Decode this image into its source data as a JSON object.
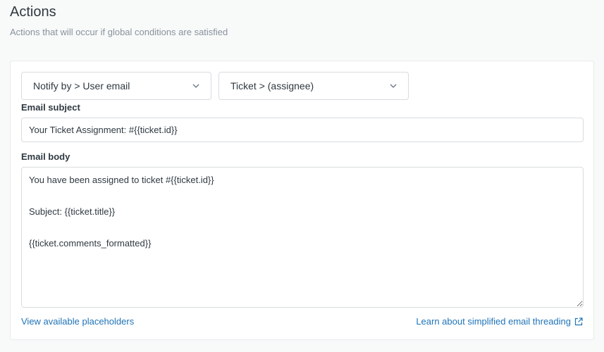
{
  "header": {
    "title": "Actions",
    "subtitle": "Actions that will occur if global conditions are satisfied"
  },
  "actions": {
    "notify_select": {
      "value": "Notify by > User email",
      "icon": "chevron-down-icon"
    },
    "recipient_select": {
      "value": "Ticket > (assignee)",
      "icon": "chevron-down-icon"
    },
    "email_subject": {
      "label": "Email subject",
      "value": "Your Ticket Assignment: #{{ticket.id}}"
    },
    "email_body": {
      "label": "Email body",
      "value": "You have been assigned to ticket #{{ticket.id}}\n\nSubject: {{ticket.title}}\n\n{{ticket.comments_formatted}}"
    },
    "links": {
      "placeholders": "View available placeholders",
      "threading": "Learn about simplified email threading",
      "threading_icon": "external-link-icon"
    }
  },
  "colors": {
    "link": "#1f73b7",
    "text": "#2f3941",
    "muted": "#87929d",
    "border": "#d8dcde"
  }
}
